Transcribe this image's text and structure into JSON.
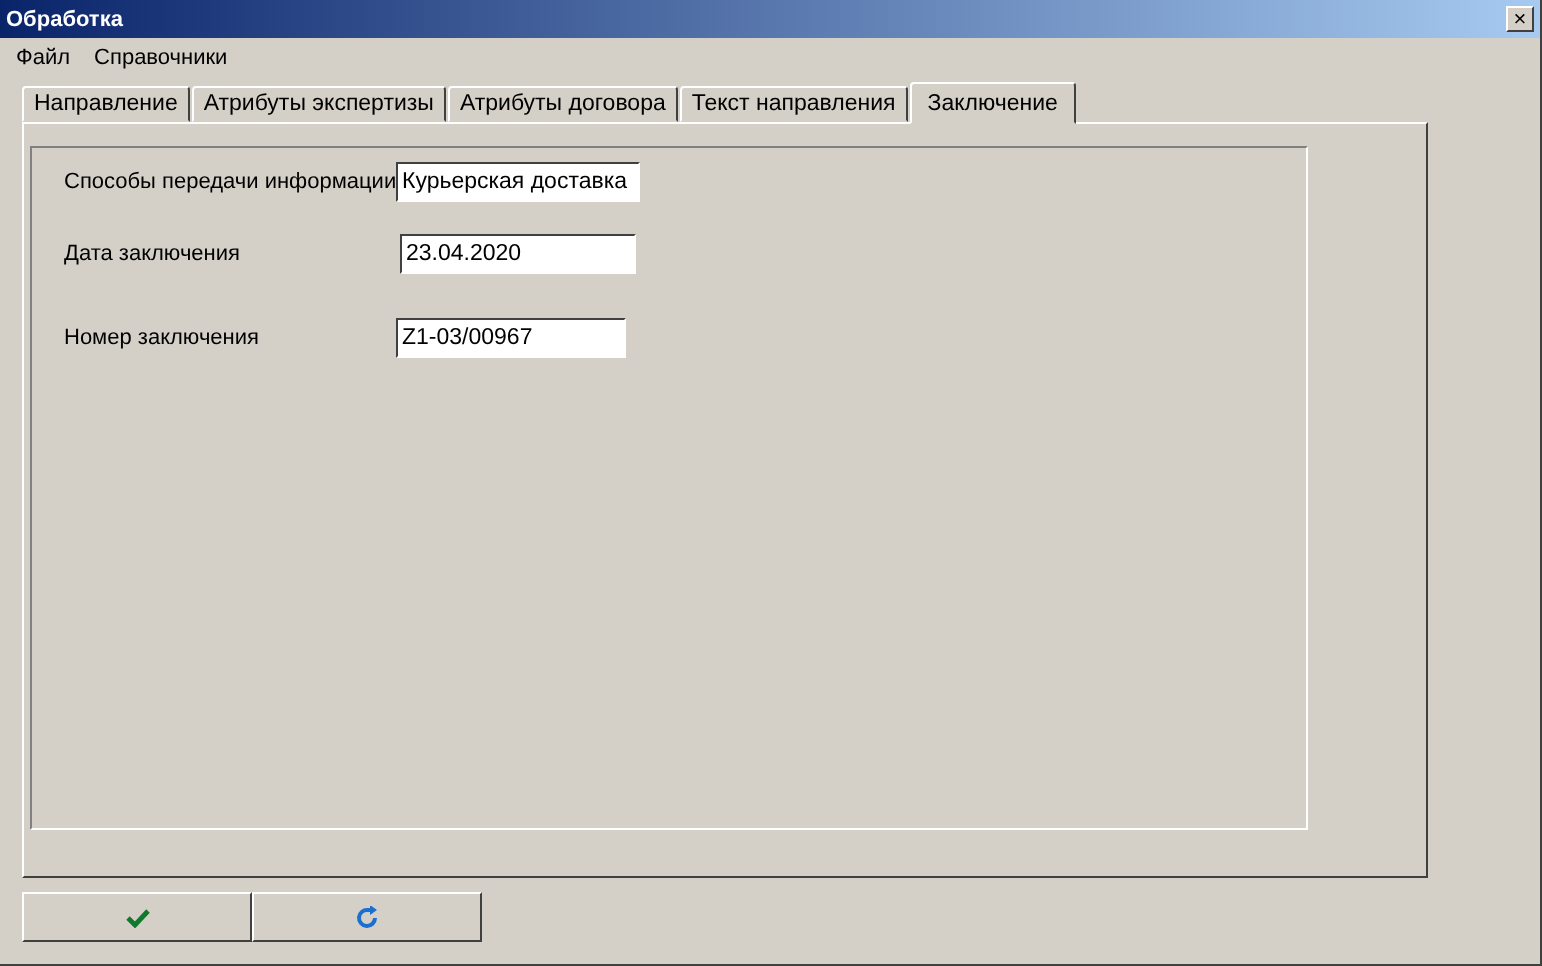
{
  "window": {
    "title": "Обработка",
    "close": "×"
  },
  "menu": [
    "Файл",
    "Справочники"
  ],
  "tabs": [
    {
      "label": "Направление",
      "selected": false
    },
    {
      "label": "Атрибуты экспертизы",
      "selected": false
    },
    {
      "label": "Атрибуты договора",
      "selected": false
    },
    {
      "label": "Текст направления",
      "selected": false
    },
    {
      "label": "Заключение",
      "selected": true
    }
  ],
  "fields": [
    {
      "label": "Способы передачи информации",
      "value": "Курьерская доставка"
    },
    {
      "label": "Дата заключения",
      "value": "23.04.2020"
    },
    {
      "label": "Номер заключения",
      "value": "Z1-03/00967"
    }
  ],
  "buttons": [
    {
      "kind": "ok"
    },
    {
      "kind": "refresh"
    }
  ]
}
